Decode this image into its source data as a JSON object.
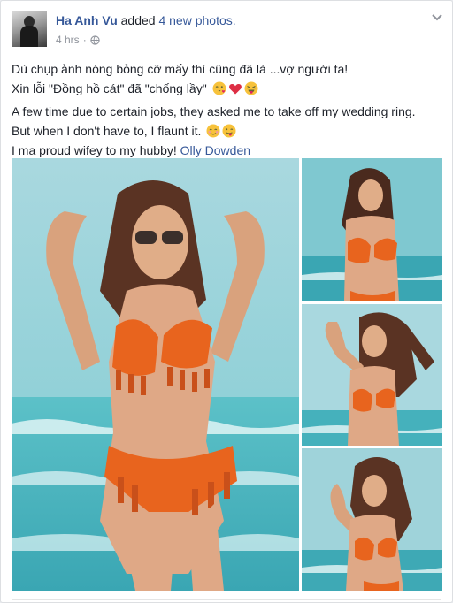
{
  "post": {
    "author": "Ha Anh Vu",
    "action": "added",
    "count_text": "4 new photos.",
    "time": "4 hrs",
    "separator": "·",
    "lines": [
      "Dù chụp ảnh nóng bỏng cỡ mấy thì cũng đã là ...vợ người ta!",
      "Xin lỗi \"Đồng hồ cát\" đã \"chống lầy\"",
      "A few time due to certain jobs, they asked me to take off my wedding ring.",
      "But when I don't have to, I flaunt it.",
      "I ma proud wifey to my hubby!"
    ],
    "tagged": "Olly Dowden",
    "line2_emojis": [
      "kiss-wink-emoji",
      "red-heart-emoji",
      "squinting-tongue-emoji"
    ],
    "line4_emojis": [
      "smiling-blush-emoji",
      "winking-tongue-emoji"
    ],
    "photo_count": 4
  },
  "colors": {
    "link": "#365899",
    "text": "#1d2129",
    "meta": "#90949c",
    "bikini": "#e8641e",
    "sea": "#5cc1c8",
    "sky": "#a9d8df"
  }
}
